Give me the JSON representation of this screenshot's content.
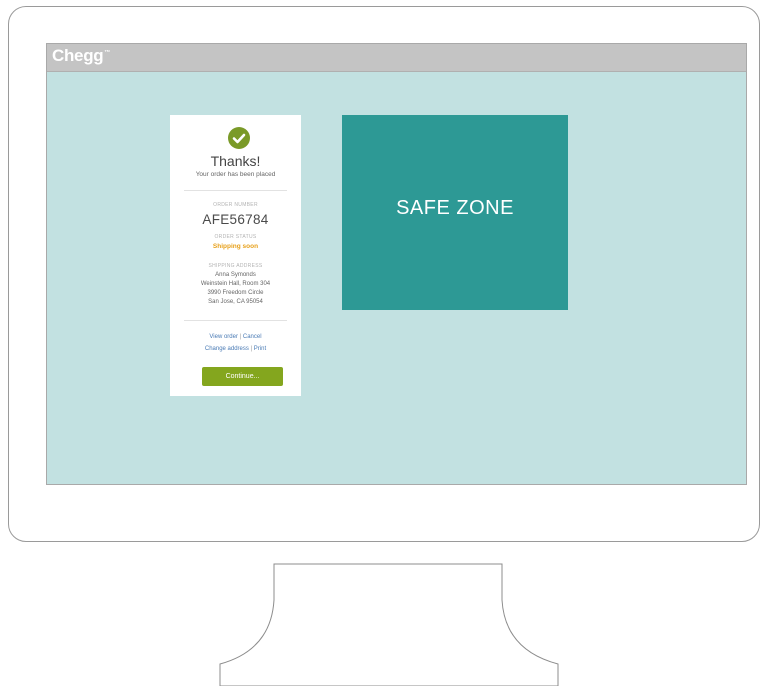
{
  "brand": {
    "name": "Chegg",
    "tm": "™"
  },
  "confirmation": {
    "title": "Thanks!",
    "subtitle": "Your order has been placed",
    "order_number_caption": "ORDER NUMBER",
    "order_number": "AFE56784",
    "order_status_caption": "ORDER STATUS",
    "order_status": "Shipping soon",
    "shipping_address_caption": "SHIPPING ADDRESS",
    "address_lines": [
      "Anna Symonds",
      "Weinstein Hall, Room 304",
      "3990 Freedom Circle",
      "San Jose, CA 95054"
    ],
    "link_view_order": "View order",
    "link_cancel": "Cancel",
    "link_change_address": "Change address",
    "link_print": "Print",
    "link_separator": "|",
    "continue_button": "Continue..."
  },
  "safe_zone": {
    "label": "SAFE ZONE"
  },
  "colors": {
    "screen_background": "#c2e1e1",
    "safe_zone": "#2d9995",
    "topbar": "#c4c4c4",
    "success_check": "#7a9a28",
    "status_orange": "#e7a01a",
    "button_green": "#84a61e"
  },
  "icons": {
    "success": "check-circle-icon"
  }
}
